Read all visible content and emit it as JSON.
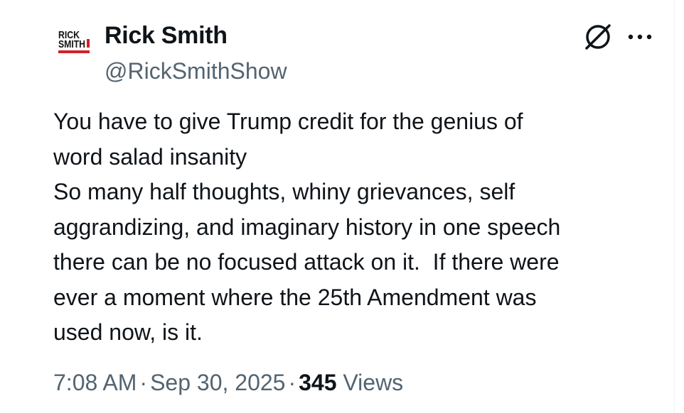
{
  "author": {
    "display_name": "Rick Smith",
    "handle": "@RickSmithShow",
    "avatar_lines": [
      "RICK",
      "SMITH"
    ]
  },
  "post": {
    "lines": [
      "You have to give Trump credit for the genius of",
      "word salad insanity",
      "So many half thoughts, whiny grievances, self",
      "aggrandizing, and imaginary history in one speech",
      "there can be no focused attack on it.  If there were",
      "ever a moment where the 25th Amendment was",
      "used now, is it."
    ]
  },
  "meta": {
    "time": "7:08 AM",
    "date": "Sep 30, 2025",
    "separator": "·",
    "views_count": "345",
    "views_label": "Views"
  },
  "icons": {
    "grok": "grok-icon",
    "more": "more-icon"
  },
  "colors": {
    "text": "#0f1419",
    "secondary": "#536471",
    "avatar_bar": "#d0202a"
  }
}
